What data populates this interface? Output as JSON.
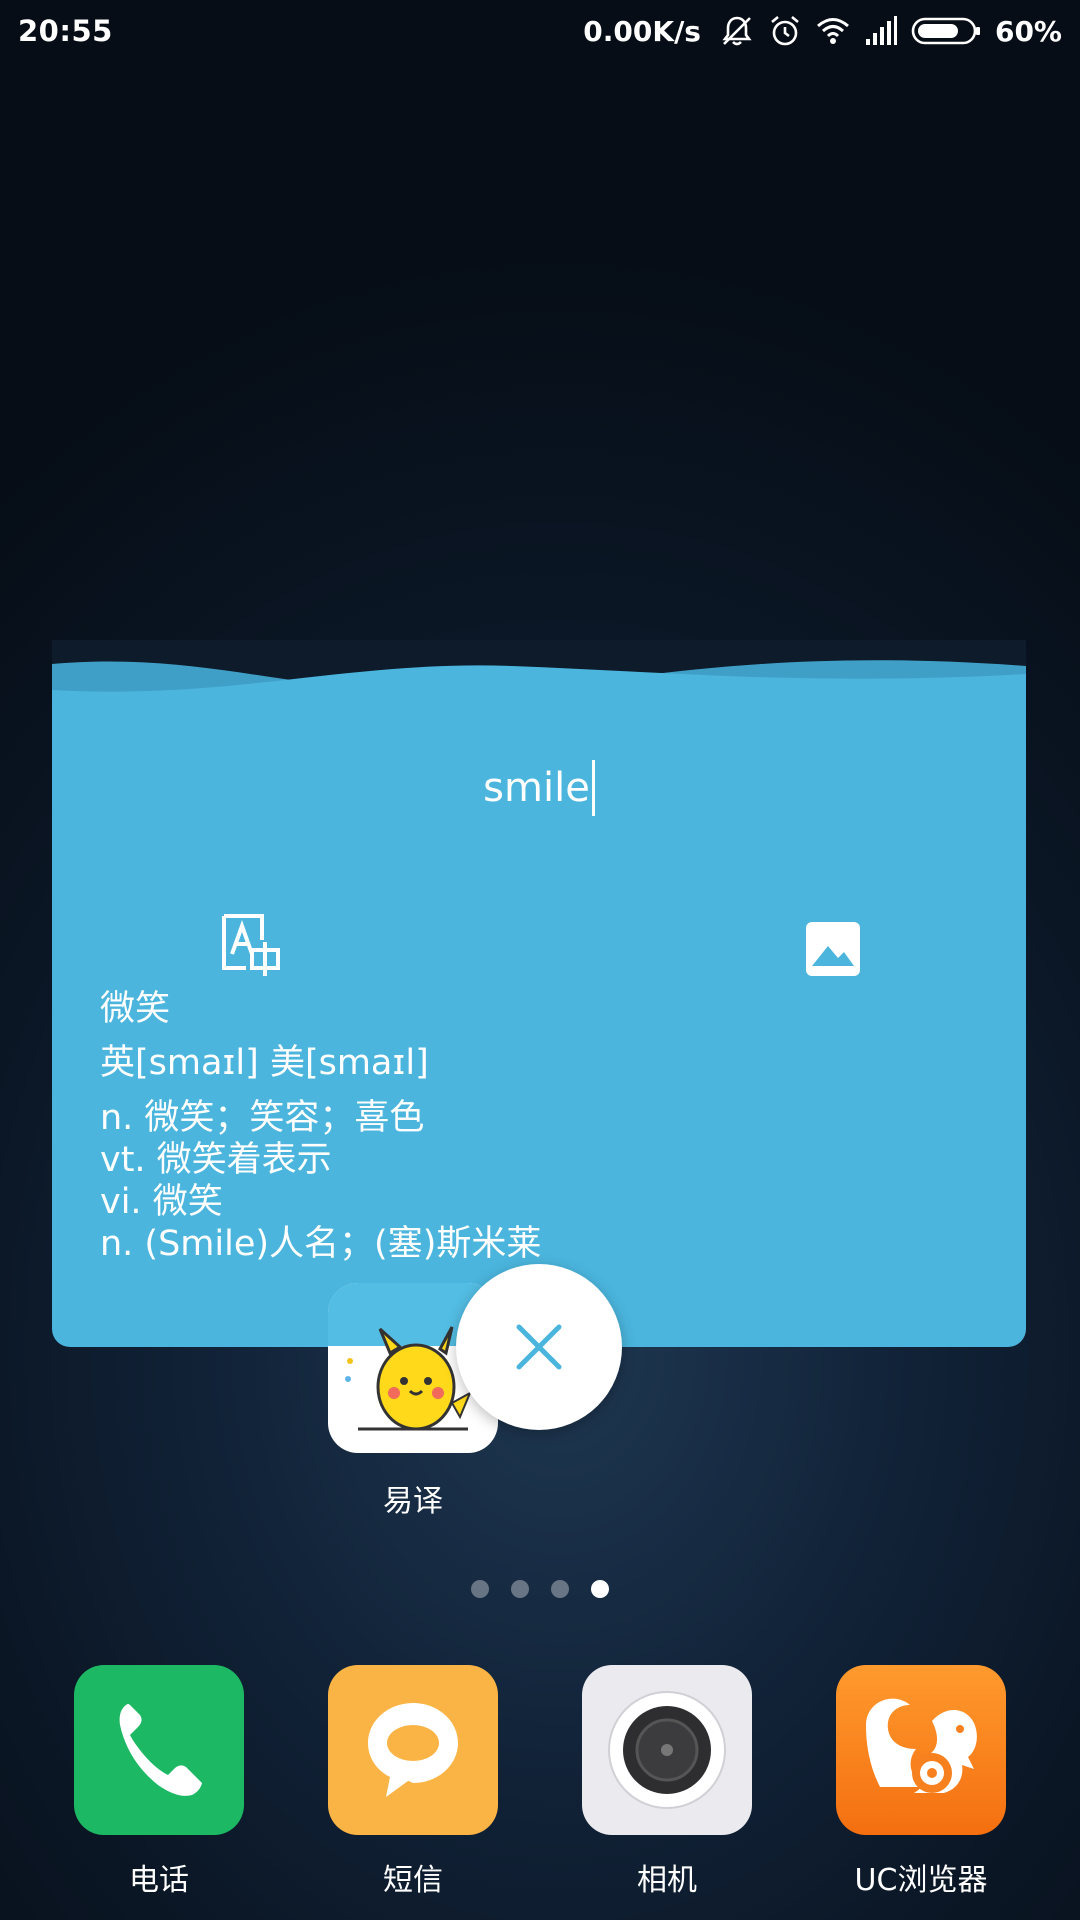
{
  "status_bar": {
    "time": "20:55",
    "net_speed": "0.00K/s",
    "battery": "60%",
    "icons": [
      "bell-off-icon",
      "alarm-icon",
      "wifi-icon",
      "signal-icon",
      "battery-icon"
    ]
  },
  "card": {
    "query": "smile",
    "tools": [
      "translate-icon",
      "image-icon"
    ],
    "result": {
      "word": "微笑",
      "phonetic": "英[smaɪl]  美[smaɪl]",
      "definitions": [
        "n. 微笑；笑容；喜色",
        "vt. 微笑着表示",
        "vi. 微笑",
        "n. (Smile)人名；(塞)斯米莱"
      ]
    }
  },
  "home_app": {
    "label": "易译"
  },
  "page_indicator": {
    "count": 4,
    "active": 4
  },
  "dock": [
    {
      "label": "电话",
      "icon": "phone-icon",
      "color": "#1db863"
    },
    {
      "label": "短信",
      "icon": "message-icon",
      "color": "#f9b445"
    },
    {
      "label": "相机",
      "icon": "camera-icon",
      "color": "#eaeaef"
    },
    {
      "label": "UC浏览器",
      "icon": "uc-squirrel-icon",
      "color": "#f7811f"
    }
  ],
  "colors": {
    "card": "#4bb5dd",
    "card_wave": "#3f9fc6"
  }
}
